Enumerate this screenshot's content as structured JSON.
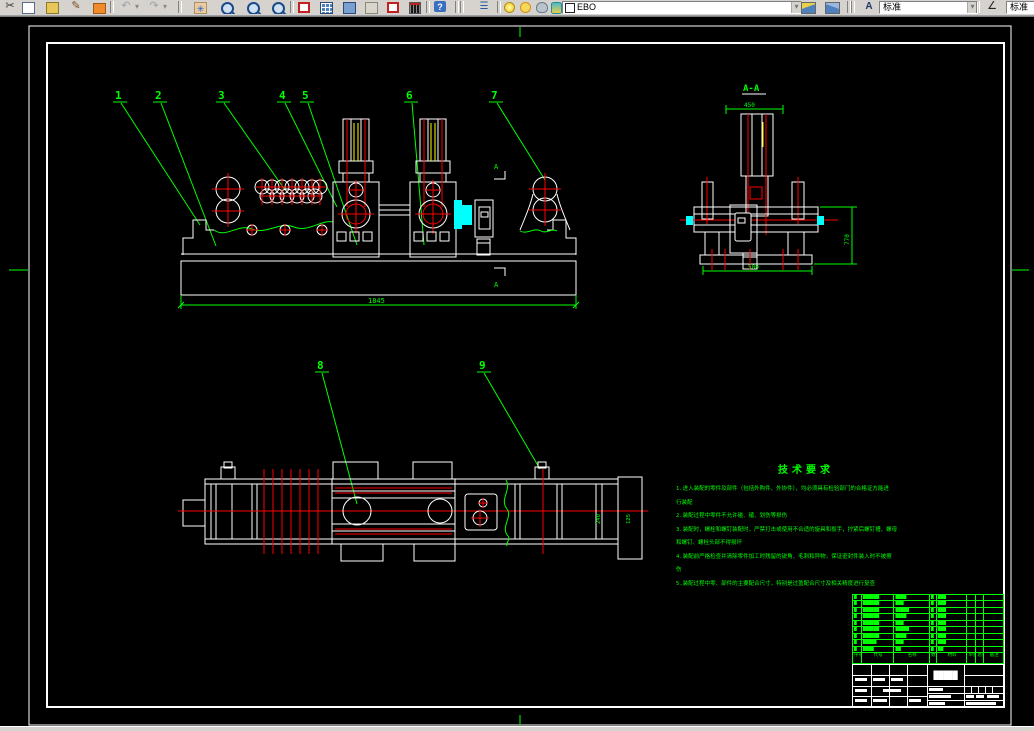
{
  "colors": {
    "canvas_bg": "#000000",
    "line_white": "#ffffff",
    "annotation_green": "#00ff00",
    "centerline_red": "#ff0000",
    "highlight_cyan": "#00ffff",
    "aux_yellow": "#ffff00",
    "toolbar_bg": "#d6d3ce"
  },
  "toolbar": {
    "layer_combo": {
      "value": "EBO"
    },
    "text_style_combo": {
      "value": "标准"
    },
    "dim_style_combo": {
      "value": "标准"
    },
    "icons": [
      "cut-icon",
      "copy-icon",
      "paste-icon",
      "brush-icon",
      "eraser-icon",
      "undo-icon",
      "redo-icon",
      "pan-icon",
      "zoom-realtime-icon",
      "zoom-window-icon",
      "zoom-previous-icon",
      "redline-icon",
      "sheet-grid-icon",
      "markup-icon",
      "render-icon",
      "red-sheet-icon",
      "calculator-icon",
      "help-icon",
      "layers-icon",
      "lightbulb-icon",
      "layer-state-icon",
      "layer-color-swatch",
      "make-layer-current-icon",
      "layer-previous-icon",
      "text-style-icon",
      "dim-style-icon"
    ]
  },
  "drawing": {
    "balloons": [
      "1",
      "2",
      "3",
      "4",
      "5",
      "6",
      "7",
      "8",
      "9"
    ],
    "section": {
      "label": "A-A",
      "mark": "A"
    },
    "dims": {
      "front_width": "1845",
      "side_top": "450",
      "side_height": "770",
      "side_bottom": "500",
      "plan_d1": "240",
      "plan_d2": "125"
    },
    "tech_req": {
      "title": "技术要求",
      "lines": [
        "1.进入装配的零件及部件（包括外购件、外协件），均必须具有检验部门的合格证方能进",
        "行装配",
        "2.装配过程中零件不允许碰、磕、划伤等损伤",
        "3.装配时，螺栓和螺钉装配时，严禁打击或使用不合适的旋具和扳手，拧紧后螺钉槽、螺母",
        "和螺钉、螺栓头部不得损坏",
        "4.装配前严格检查并清除零件加工时残留的锐角、毛刺和异物，保证密封件装入时不被擦",
        "伤",
        "5.装配过程中零、部件的主要配合尺寸，特别是过盈配合尺寸及相关精度进行复查"
      ]
    }
  },
  "bom": {
    "headers": [
      "序号",
      "代号",
      "名称",
      "数量",
      "材料",
      "单重",
      "总重",
      "备注"
    ],
    "rows": [
      [
        "█",
        "██████",
        "████",
        "█",
        "███"
      ],
      [
        "█",
        "██████",
        "███",
        "█",
        "███"
      ],
      [
        "█",
        "██████",
        "█████",
        "█",
        "███"
      ],
      [
        "█",
        "██████",
        "████",
        "█",
        "███"
      ],
      [
        "█",
        "██████",
        "███",
        "█",
        "███"
      ],
      [
        "█",
        "██████",
        "█████",
        "█",
        "███"
      ],
      [
        "█",
        "██████",
        "████",
        "█",
        "███"
      ],
      [
        "█",
        "█████",
        "███",
        "█",
        "███"
      ],
      [
        "█",
        "████",
        "██",
        "█",
        "██"
      ]
    ]
  },
  "title_block": {
    "title": "█████"
  }
}
